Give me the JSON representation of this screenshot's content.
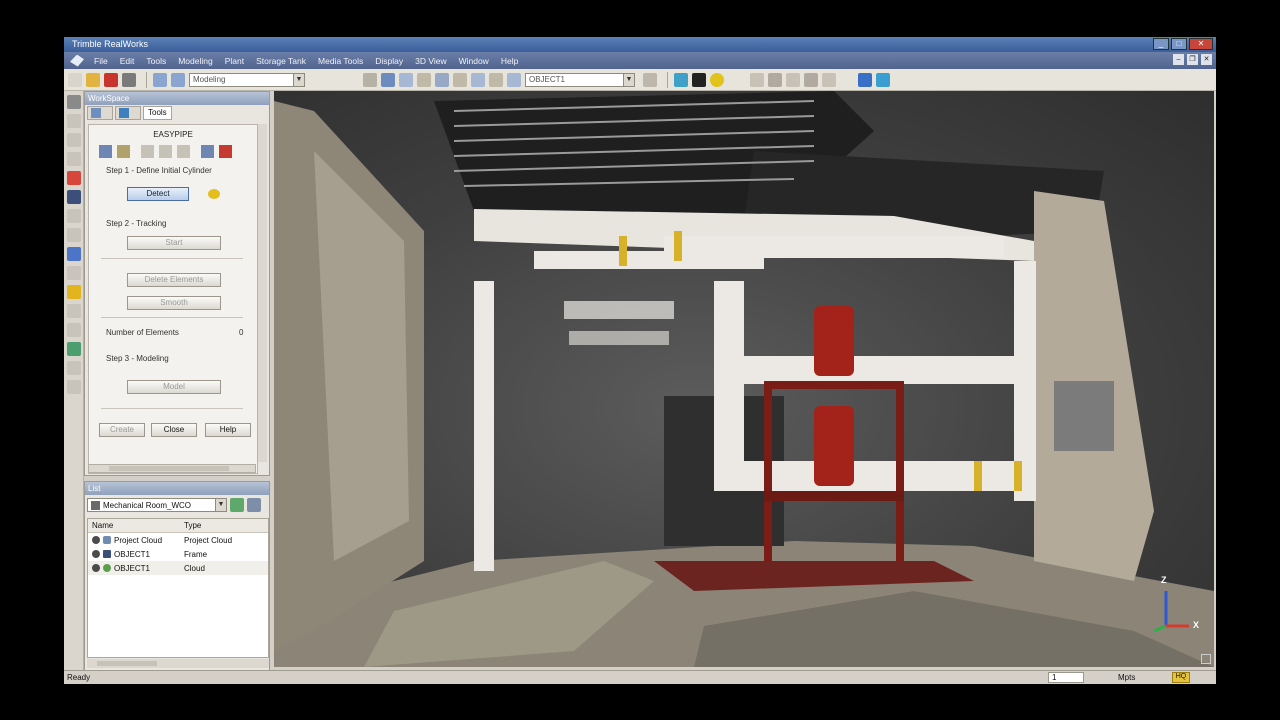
{
  "window": {
    "title": "Trimble RealWorks",
    "minimize": "_",
    "maximize": "□",
    "close": "✕"
  },
  "menu": [
    "File",
    "Edit",
    "Tools",
    "Modeling",
    "Plant",
    "Storage Tank",
    "Media Tools",
    "Display",
    "3D View",
    "Window",
    "Help"
  ],
  "toolbar": {
    "mode_combo": "Modeling",
    "object_combo": "OBJECT1"
  },
  "workspace": {
    "title": "WorkSpace",
    "tabs": [
      "",
      "",
      "Tools"
    ],
    "panel_title": "EASYPIPE",
    "step1": "Step 1 - Define Initial Cylinder",
    "detect": "Detect",
    "step2": "Step 2 - Tracking",
    "start": "Start",
    "delete_elements": "Delete Elements",
    "smooth": "Smooth",
    "number_label": "Number of Elements",
    "number_value": "0",
    "step3": "Step 3 - Modeling",
    "model": "Model",
    "create": "Create",
    "close": "Close",
    "help": "Help"
  },
  "list": {
    "title": "List",
    "project_combo": "Mechanical Room_WCO",
    "headers": {
      "name": "Name",
      "type": "Type"
    },
    "rows": [
      {
        "name": "Project Cloud",
        "type": "Project Cloud"
      },
      {
        "name": "OBJECT1",
        "type": "Frame"
      },
      {
        "name": "OBJECT1",
        "type": "Cloud"
      }
    ]
  },
  "viewport": {
    "axis_z": "Z",
    "axis_x": "X"
  },
  "status": {
    "ready": "Ready",
    "value": "1",
    "unit": "Mpts",
    "hq": "HQ"
  },
  "colors": {
    "titlebar": "#3a5f9a",
    "menubar": "#50648e",
    "accent_selected": "#4a6da8",
    "pipe_red": "#8e1b16",
    "hq": "#e4c23a"
  }
}
